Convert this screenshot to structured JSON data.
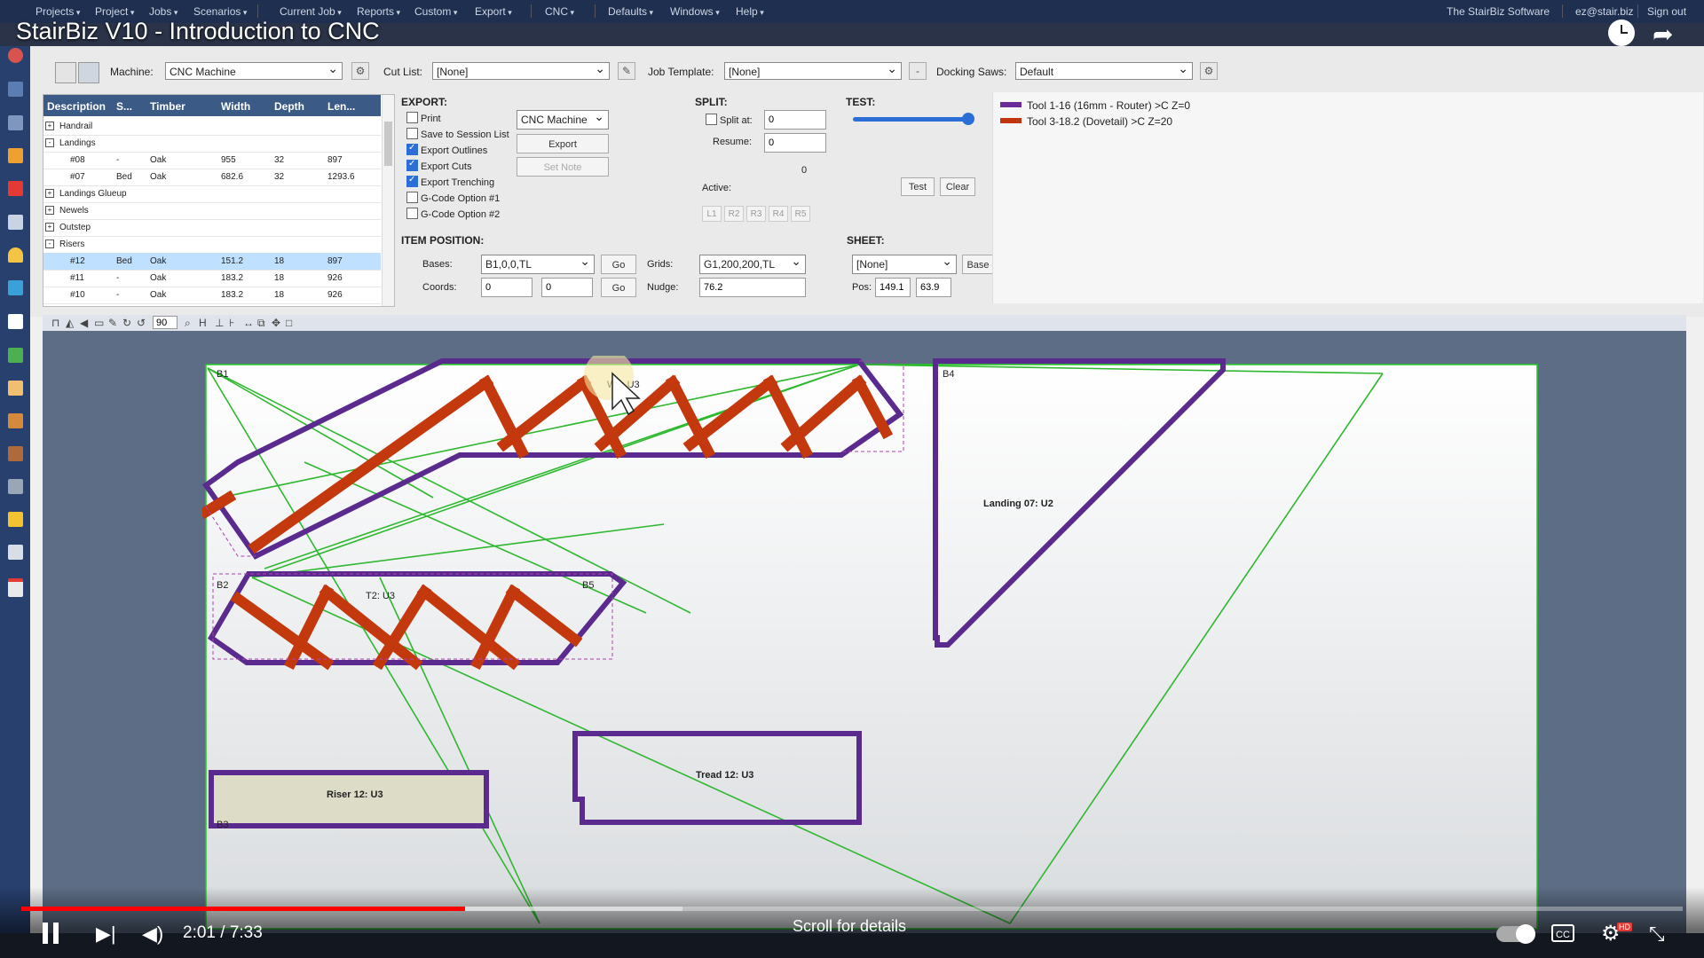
{
  "menubar": {
    "items": [
      "Projects",
      "Project",
      "Jobs",
      "Scenarios",
      "Current Job",
      "Reports",
      "Custom",
      "Export",
      "CNC",
      "Defaults",
      "Windows",
      "Help"
    ],
    "right": [
      "The StairBiz Software",
      "ez@stair.biz",
      "Sign out"
    ]
  },
  "video": {
    "title": "StairBiz V10 - Introduction to CNC",
    "time": "2:01 / 7:33",
    "progress_percent": 26.7,
    "scroll_hint": "Scroll for details"
  },
  "toolbar": {
    "machine_label": "Machine:",
    "machine_value": "CNC Machine",
    "cutlist_label": "Cut List:",
    "cutlist_value": "[None]",
    "template_label": "Job Template:",
    "template_value": "[None]",
    "docking_label": "Docking Saws:",
    "docking_value": "Default"
  },
  "grid": {
    "headers": [
      "Description",
      "S...",
      "Timber",
      "Width",
      "Depth",
      "Len..."
    ],
    "rows": [
      {
        "group": "Handrail",
        "exp": "+"
      },
      {
        "group": "Landings",
        "exp": "-"
      },
      {
        "desc": "#08",
        "s": "-",
        "timber": "Oak",
        "width": "955",
        "depth": "32",
        "len": "897"
      },
      {
        "desc": "#07",
        "s": "Bed",
        "timber": "Oak",
        "width": "682.6",
        "depth": "32",
        "len": "1293.6"
      },
      {
        "group": "Landings Glueup",
        "exp": "+"
      },
      {
        "group": "Newels",
        "exp": "+"
      },
      {
        "group": "Outstep",
        "exp": "+"
      },
      {
        "group": "Risers",
        "exp": "-"
      },
      {
        "desc": "#12",
        "s": "Bed",
        "timber": "Oak",
        "width": "151.2",
        "depth": "18",
        "len": "897"
      },
      {
        "desc": "#11",
        "s": "-",
        "timber": "Oak",
        "width": "183.2",
        "depth": "18",
        "len": "926"
      },
      {
        "desc": "#10",
        "s": "-",
        "timber": "Oak",
        "width": "183.2",
        "depth": "18",
        "len": "926"
      }
    ]
  },
  "export": {
    "title": "EXPORT:",
    "options": [
      {
        "label": "Print",
        "checked": false
      },
      {
        "label": "Save to Session List",
        "checked": false
      },
      {
        "label": "Export Outlines",
        "checked": true
      },
      {
        "label": "Export Cuts",
        "checked": true
      },
      {
        "label": "Export Trenching",
        "checked": true
      },
      {
        "label": "G-Code Option #1",
        "checked": false
      },
      {
        "label": "G-Code Option #2",
        "checked": false
      }
    ],
    "machine_value": "CNC Machine",
    "export_btn": "Export",
    "setnote_btn": "Set Note"
  },
  "split": {
    "title": "SPLIT:",
    "split_at_label": "Split at:",
    "split_at_value": "0",
    "resume_label": "Resume:",
    "resume_value": "0",
    "count": "0",
    "active_label": "Active:",
    "active_buttons": [
      "L1",
      "R2",
      "R3",
      "R4",
      "R5"
    ]
  },
  "test": {
    "title": "TEST:",
    "slider_value_percent": 100,
    "test_btn": "Test",
    "clear_btn": "Clear"
  },
  "position": {
    "title": "ITEM POSITION:",
    "bases_label": "Bases:",
    "bases_value": "B1,0,0,TL",
    "go": "Go",
    "coords_label": "Coords:",
    "coord_x": "0",
    "coord_y": "0",
    "grids_label": "Grids:",
    "grids_value": "G1,200,200,TL",
    "nudge_label": "Nudge:",
    "nudge_value": "76.2"
  },
  "sheet": {
    "title": "SHEET:",
    "value": "[None]",
    "base_btn": "Base",
    "pos_label": "Pos:",
    "pos_x": "149.1",
    "pos_y": "63.9"
  },
  "legend": {
    "items": [
      {
        "label": "Tool 1-16 (16mm - Router) >C Z=0",
        "color": "#6a2a9a"
      },
      {
        "label": "Tool 3-18.2 (Dovetail) >C Z=20",
        "color": "#c0350e"
      }
    ]
  },
  "canvas_toolbar": {
    "zoom_value": "90",
    "h_label": "H"
  },
  "drawing": {
    "labels": {
      "b1": "B1",
      "b2": "B2",
      "b3": "B3",
      "b4": "B4",
      "b5": "B5",
      "w_u3": "W1: U3",
      "t2_u3": "T2: U3",
      "landing": "Landing 07: U2",
      "riser": "Riser 12: U3",
      "tread": "Tread 12: U3"
    },
    "colors": {
      "outline": "#5b2a8e",
      "cut": "#c3380d",
      "path": "#2fb82f",
      "sheet_edge": "#22cc22"
    }
  }
}
